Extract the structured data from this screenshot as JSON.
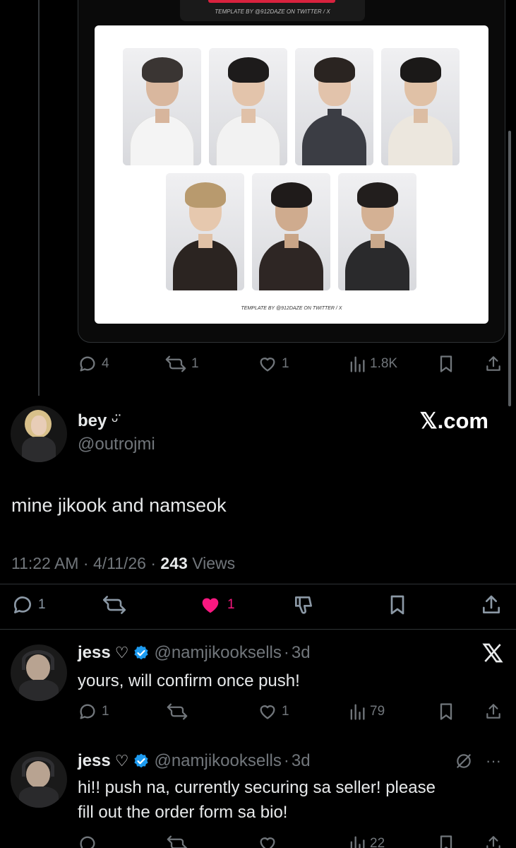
{
  "quoted_post": {
    "template_credit_top": "TEMPLATE BY @912DAZE ON TWITTER / X",
    "template_credit_bottom": "TEMPLATE BY @912DAZE ON TWITTER / X",
    "photocards": [
      {
        "icon": "member-photocard-1"
      },
      {
        "icon": "member-photocard-2"
      },
      {
        "icon": "member-photocard-3"
      },
      {
        "icon": "member-photocard-4"
      },
      {
        "icon": "member-photocard-5"
      },
      {
        "icon": "member-photocard-6"
      },
      {
        "icon": "member-photocard-7"
      }
    ],
    "actions": {
      "replies": "4",
      "reposts": "1",
      "likes": "1",
      "views": "1.8K"
    }
  },
  "main_post": {
    "display_name": "bey",
    "name_emoji": "ᵕ̈",
    "handle": "@outrojmi",
    "watermark": "𝕏.com",
    "text": "mine jikook and namseok",
    "time": "11:22 AM",
    "sep1": "·",
    "date": "4/11/26",
    "sep2": "·",
    "views_count": "243",
    "views_label": "Views",
    "actions": {
      "replies": "1",
      "likes": "1"
    },
    "like_color": "#f91880"
  },
  "replies": [
    {
      "display_name": "jess",
      "heart": "♡",
      "handle": "@namjikooksells",
      "dot": "·",
      "age": "3d",
      "text": "yours, will confirm once push!",
      "actions": {
        "replies": "1",
        "likes": "1",
        "views": "79"
      },
      "corner_icon": "x-logo-icon"
    },
    {
      "display_name": "jess",
      "heart": "♡",
      "handle": "@namjikooksells",
      "dot": "·",
      "age": "3d",
      "text_line1": "hi!! push na, currently securing sa seller! please",
      "text_line2": "fill out the order form sa bio!",
      "more": "···",
      "views": "22",
      "corner_icon": "grok-icon"
    }
  ],
  "colors": {
    "background": "#000000",
    "muted": "#71767b",
    "verified": "#1d9bf0",
    "like": "#f91880"
  }
}
